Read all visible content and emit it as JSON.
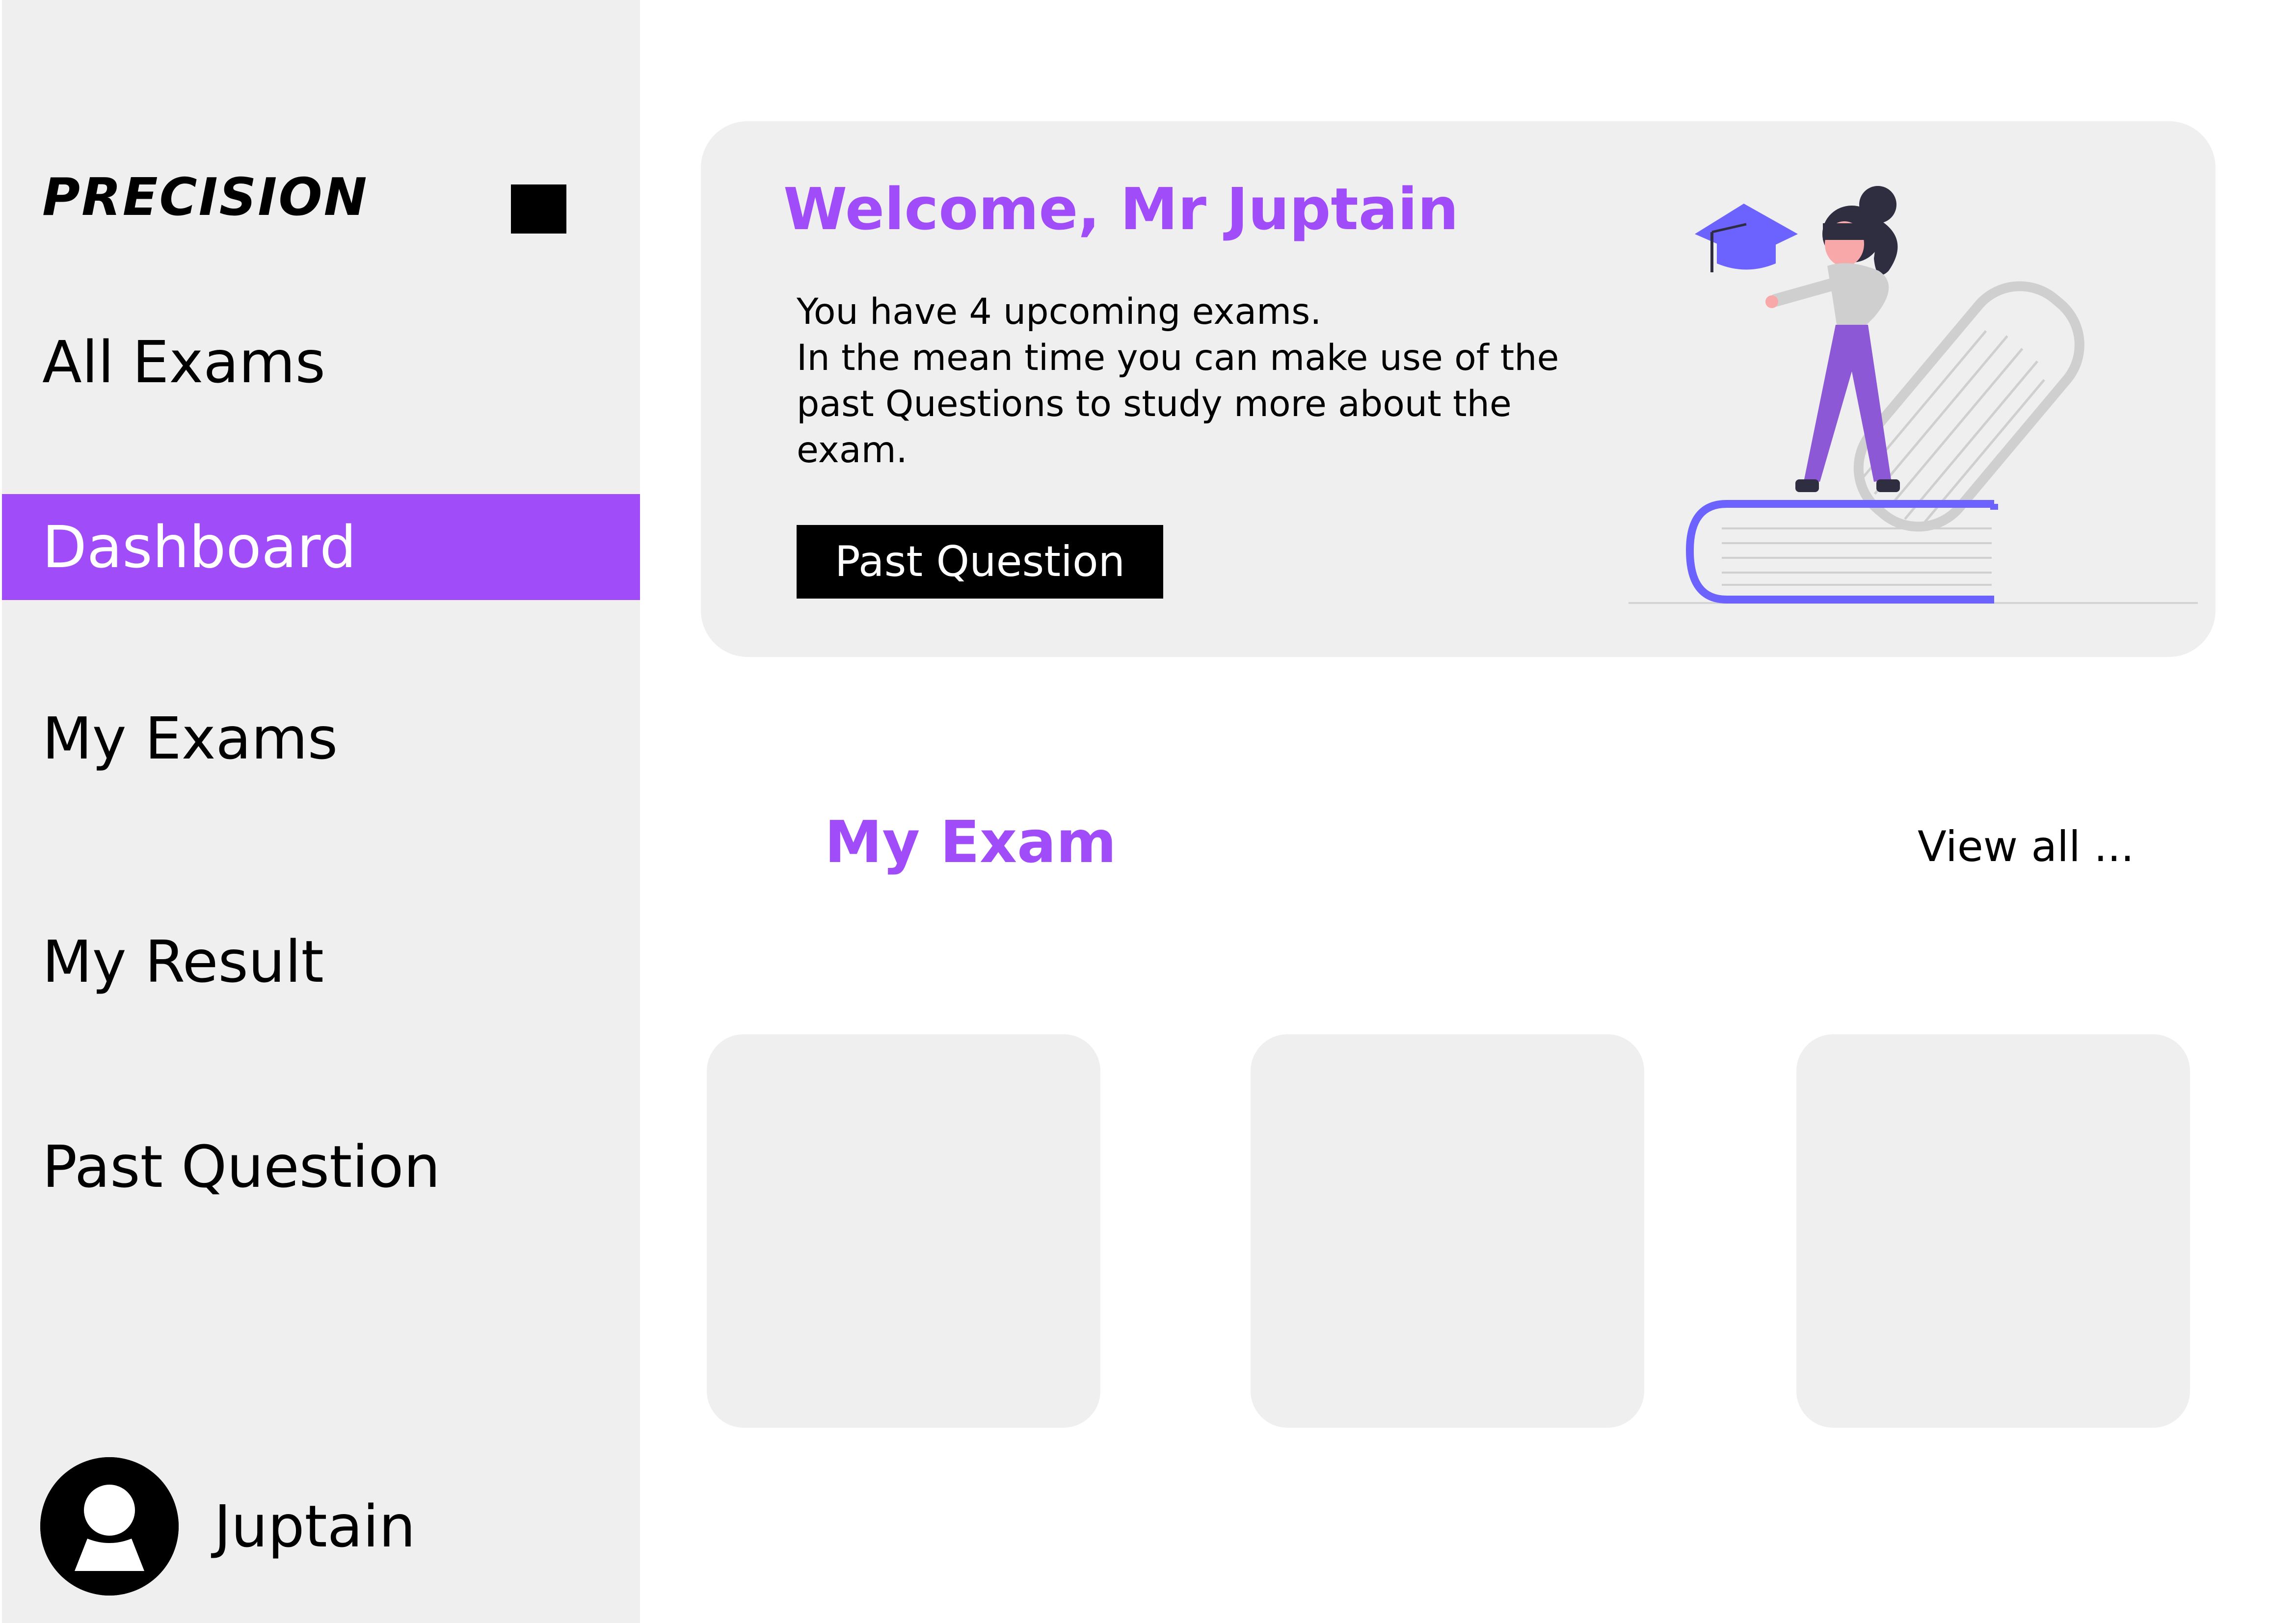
{
  "sidebar": {
    "logo_text": "PRECISION",
    "items": [
      {
        "label": "All Exams",
        "active": false
      },
      {
        "label": "Dashboard",
        "active": true
      },
      {
        "label": "My Exams",
        "active": false
      },
      {
        "label": "My Result",
        "active": false
      },
      {
        "label": "Past Question",
        "active": false
      }
    ],
    "user": {
      "name": "Juptain",
      "avatar_icon": "user-icon"
    }
  },
  "welcome": {
    "title": "Welcome, Mr Juptain",
    "lines": [
      "You have 4 upcoming exams.",
      "In the mean time you can make use of the",
      "past Questions to study more about the",
      "exam."
    ],
    "button_label": "Past Question",
    "illustration_icon": "student-on-books-illustration"
  },
  "my_exam": {
    "title": "My Exam",
    "view_all_label": "View all ..."
  },
  "colors": {
    "accent": "#a04cf8",
    "panel": "#efefef",
    "text": "#000000",
    "illustration_blue": "#6c63ff"
  }
}
